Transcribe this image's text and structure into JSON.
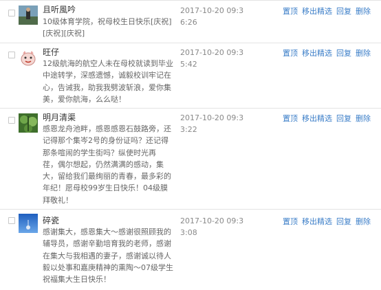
{
  "action_labels": {
    "pin": "置顶",
    "unfeature": "移出精选",
    "reply": "回复",
    "delete": "删除"
  },
  "comments": [
    {
      "name": "且听風吟",
      "avatar": "photo-avatar",
      "content_lines": [
        "10级体育学院，祝母校生日快乐[庆祝]",
        "[庆祝][庆祝]"
      ],
      "date_line1": "2017-10-20 09:3",
      "date_line2": "6:26"
    },
    {
      "name": "旺仔",
      "avatar": "cartoon-avatar",
      "content_lines": [
        "12级航海的航空人未在母校就读到毕业",
        "中途转学，深感遗憾，诚毅校训牢记在",
        "心，告诫我，助我我劈波斩浪，爱你集",
        "美，爱你航海，么么哒！"
      ],
      "date_line1": "2017-10-20 09:3",
      "date_line2": "5:42"
    },
    {
      "name": "明月清渠",
      "avatar": "plant-avatar",
      "content_lines": [
        "感恩龙舟池畔，感恩感恩石鼓路旁，还",
        "记得那个集岑2号的身份证吗？还记得",
        "那条喧闹的学生街吗？纵使时光再",
        "荏，偶尔想起，仍然满满的感动，集",
        "大，留给我们最绚丽的青春，最多彩的",
        "年纪！愿母校99岁生日快乐！04级膜",
        "拜敬礼！"
      ],
      "date_line1": "2017-10-20 09:3",
      "date_line2": "3:22"
    },
    {
      "name": "碎瓷",
      "avatar": "sky-avatar",
      "content_lines": [
        "感谢集大，感恩集大～感谢很照顾我的",
        "辅导员，感谢辛勤培育我的老师，感谢",
        "在集大与我相遇的妻子，感谢诚以待人",
        "毅以处事和嘉庚精神的熏陶～07级学生",
        "祝福集大生日快乐！"
      ],
      "date_line1": "2017-10-20 09:3",
      "date_line2": "3:08"
    }
  ]
}
